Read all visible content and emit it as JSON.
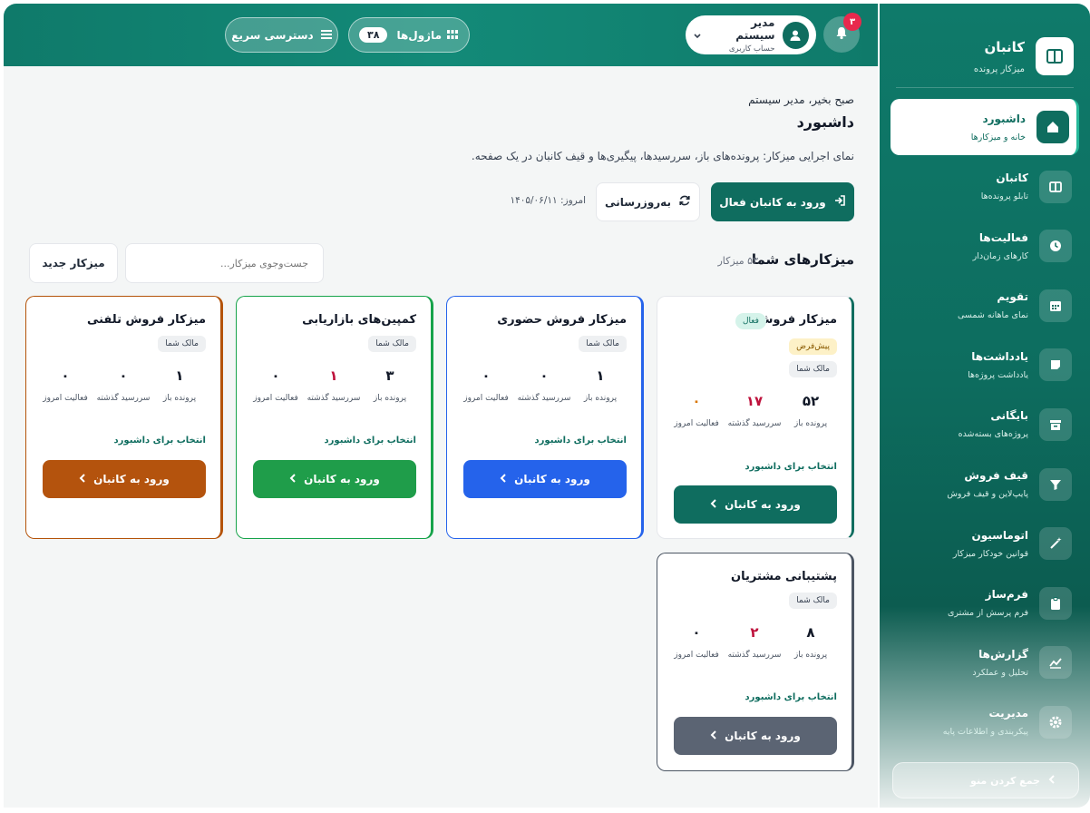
{
  "sidebar": {
    "brand_title": "کانبان",
    "brand_subtitle": "میزکار پرونده",
    "items": [
      {
        "label": "داشبورد",
        "sub": "خانه و میزکارها",
        "icon": "home-icon",
        "active": true
      },
      {
        "label": "کانبان",
        "sub": "تابلو پرونده‌ها",
        "icon": "kanban-icon",
        "active": false
      },
      {
        "label": "فعالیت‌ها",
        "sub": "کارهای زمان‌دار",
        "icon": "clock-icon",
        "active": false
      },
      {
        "label": "تقویم",
        "sub": "نمای ماهانه شمسی",
        "icon": "calendar-icon",
        "active": false
      },
      {
        "label": "یادداشت‌ها",
        "sub": "یادداشت پروژه‌ها",
        "icon": "note-icon",
        "active": false
      },
      {
        "label": "بایگانی",
        "sub": "پروژه‌های بسته‌شده",
        "icon": "archive-icon",
        "active": false
      },
      {
        "label": "قیف فروش",
        "sub": "پایپ‌لاین و قیف فروش",
        "icon": "funnel-icon",
        "active": false
      },
      {
        "label": "اتوماسیون",
        "sub": "قوانین خودکار میزکار",
        "icon": "magic-wand-icon",
        "active": false
      },
      {
        "label": "فرم‌ساز",
        "sub": "فرم پرسش از مشتری",
        "icon": "clipboard-icon",
        "active": false
      },
      {
        "label": "گزارش‌ها",
        "sub": "تحلیل و عملکرد",
        "icon": "chart-icon",
        "active": false
      },
      {
        "label": "مدیریت",
        "sub": "پیکربندی و اطلاعات پایه",
        "icon": "gear-icon",
        "active": false
      }
    ],
    "collapse_label": "جمع کردن منو"
  },
  "topbar": {
    "notification_count": "۳",
    "user_name": "مدیر سیستم",
    "user_role": "حساب کاربری",
    "modules_label": "ماژول‌ها",
    "modules_count": "۳۸",
    "quick_access_label": "دسترسی سریع"
  },
  "main": {
    "greeting": "صبح بخیر، مدیر سیستم",
    "title": "داشبورد",
    "description": "نمای اجرایی میزکار: پرونده‌های باز، سررسیدها، پیگیری‌ها و قیف کانبان در یک صفحه.",
    "enter_active_label": "ورود به کانبان فعال",
    "refresh_label": "به‌روزرسانی",
    "today_label": "امروز: ۱۴۰۵/۰۶/۱۱",
    "section_title": "میزکارهای شما",
    "section_count": "۵۳ میزکار",
    "search_placeholder": "جست‌وجوی میزکار...",
    "new_workspace_label": "میزکار جدید"
  },
  "card_common": {
    "owner_badge": "مالک شما",
    "open_label": "پرونده باز",
    "overdue_label": "سررسید گذشته",
    "activity_label": "فعالیت امروز",
    "select_label": "انتخاب برای داشبورد",
    "enter_label": "ورود به کانبان"
  },
  "cards": [
    {
      "title": "میزکار فروش",
      "active_badge": "فعال",
      "default_badge": "پیش‌فرض",
      "open": "۵۲",
      "overdue": "۱۷",
      "activity": "۰",
      "accent": "#0f6d5f",
      "btn_color": "#0f6d5f"
    },
    {
      "title": "میزکار فروش حضوری",
      "open": "۱",
      "overdue": "۰",
      "activity": "۰",
      "accent": "#2563eb",
      "btn_color": "#2563eb"
    },
    {
      "title": "کمپین‌های بازاریابی",
      "open": "۳",
      "overdue": "۱",
      "activity": "۰",
      "accent": "#16a34a",
      "btn_color": "#1f9d4a"
    },
    {
      "title": "میزکار فروش تلفنی",
      "open": "۱",
      "overdue": "۰",
      "activity": "۰",
      "accent": "#b45309",
      "btn_color": "#b4530d"
    },
    {
      "title": "پشتیبانی مشتریان",
      "open": "۸",
      "overdue": "۲",
      "activity": "۰",
      "accent": "#4b5563",
      "btn_color": "#5b6473"
    }
  ]
}
